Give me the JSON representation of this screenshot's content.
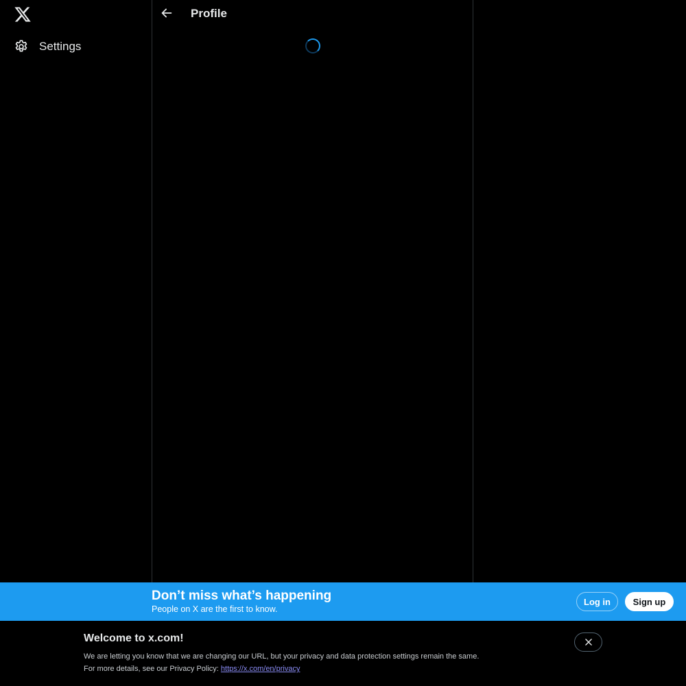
{
  "nav": {
    "logo_icon": "x-logo-icon",
    "items": [
      {
        "label": "Settings",
        "icon": "gear-icon"
      }
    ]
  },
  "header": {
    "back_icon": "arrow-left-icon",
    "title": "Profile"
  },
  "bottom_bar": {
    "headline": "Don’t miss what’s happening",
    "subline": "People on X are the first to know.",
    "login_label": "Log in",
    "signup_label": "Sign up",
    "background_color": "#1d9bf0"
  },
  "welcome": {
    "title": "Welcome to x.com!",
    "line1": "We are letting you know that we are changing our URL, but your privacy and data protection settings remain the same.",
    "line2_prefix": "For more details, see our Privacy Policy: ",
    "privacy_link": "https://x.com/en/privacy",
    "close_icon": "close-icon"
  }
}
